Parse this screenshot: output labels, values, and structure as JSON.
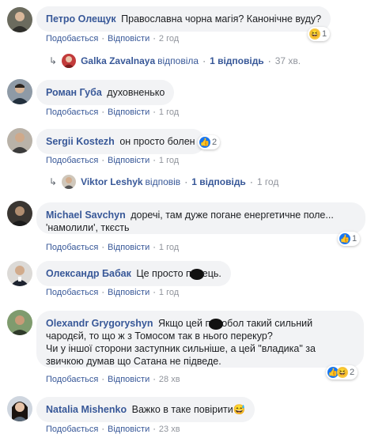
{
  "comments": [
    {
      "author": "Петро Олещук",
      "text": "Православна чорна магія? Канонічне вуду?",
      "like_label": "Подобається",
      "reply_label": "Відповісти",
      "time": "2 год",
      "reactions": {
        "icons": [
          "haha-icon"
        ],
        "count": "1"
      },
      "reply": {
        "name": "Galka Zavalnaya",
        "verb": "відповіла",
        "count": "1 відповідь",
        "time": "37 хв."
      }
    },
    {
      "author": "Роман Губа",
      "text": "духовненько",
      "like_label": "Подобається",
      "reply_label": "Відповісти",
      "time": "1 год"
    },
    {
      "author": "Sergii Kostezh",
      "text": "он просто болен",
      "like_label": "Подобається",
      "reply_label": "Відповісти",
      "time": "1 год",
      "reactions": {
        "icons": [
          "like-icon"
        ],
        "count": "2"
      },
      "reply": {
        "name": "Viktor Leshyk",
        "verb": "відповів",
        "count": "1 відповідь",
        "time": "1 год"
      }
    },
    {
      "author": "Michael Savchyn",
      "text_line1": "доречі, там дуже погане енергетичне поле...",
      "text_line2": "'намолили', ткєсть",
      "like_label": "Подобається",
      "reply_label": "Відповісти",
      "time": "1 год",
      "reactions": {
        "icons": [
          "like-icon"
        ],
        "count": "1"
      }
    },
    {
      "author": "Олександр Бабак",
      "text_before": "Це просто п",
      "text_after": "ець.",
      "like_label": "Подобається",
      "reply_label": "Відповісти",
      "time": "1 год"
    },
    {
      "author": "Olexandr Grygoryshyn",
      "text_line1a": "Якщо цей п",
      "text_line1b": "обол такий сильний",
      "text_line2": "чародєй, то що ж з Томосом так в нього перекур?",
      "text_line3": "Чи у іншої сторони заступник сильніше, а цей \"владика\" за",
      "text_line4": "звичкою думав що Сатана не підведе.",
      "like_label": "Подобається",
      "reply_label": "Відповісти",
      "time": "28 хв",
      "reactions": {
        "icons": [
          "like-icon",
          "haha-icon"
        ],
        "count": "2"
      }
    },
    {
      "author": "Natalia Mishenko",
      "text": "Важко в таке повірити",
      "emoji": "😅",
      "like_label": "Подобається",
      "reply_label": "Відповісти",
      "time": "23 хв"
    }
  ]
}
